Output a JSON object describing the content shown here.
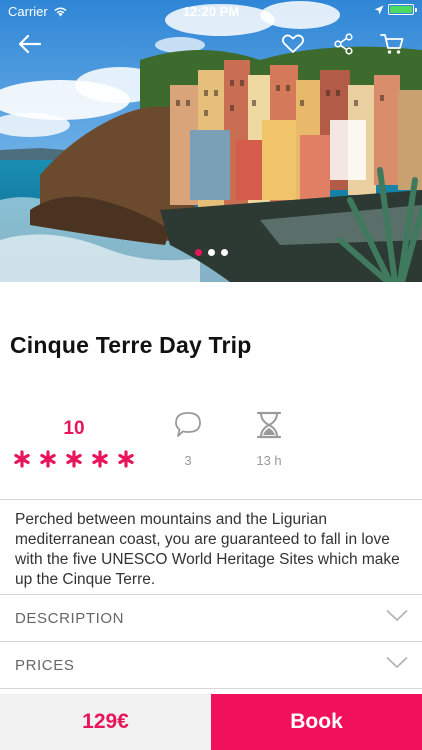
{
  "status_bar": {
    "carrier": "Carrier",
    "time": "12:20 PM",
    "wifi_icon": "wifi-icon",
    "location_icon": "location-arrow-icon",
    "battery_icon": "battery-icon"
  },
  "nav": {
    "back_icon": "arrow-left-icon",
    "favorite_icon": "heart-outline-icon",
    "share_icon": "share-icon",
    "cart_icon": "cart-icon"
  },
  "gallery": {
    "count": 3,
    "active_index": 0
  },
  "tour": {
    "title": "Cinque Terre Day Trip",
    "rating_score": "10",
    "rating_stars": 5,
    "comments_count": "3",
    "duration": "13 h",
    "summary": "Perched between mountains and the Ligurian mediterranean coast, you are guaranteed to fall in love with the five UNESCO World Heritage Sites which make up the Cinque Terre."
  },
  "sections": [
    {
      "label": "DESCRIPTION"
    },
    {
      "label": "PRICES"
    }
  ],
  "footer": {
    "price": "129€",
    "book_label": "Book"
  },
  "colors": {
    "accent": "#e8155b",
    "book_button": "#f0105c",
    "price_background": "#f2f2f2"
  }
}
